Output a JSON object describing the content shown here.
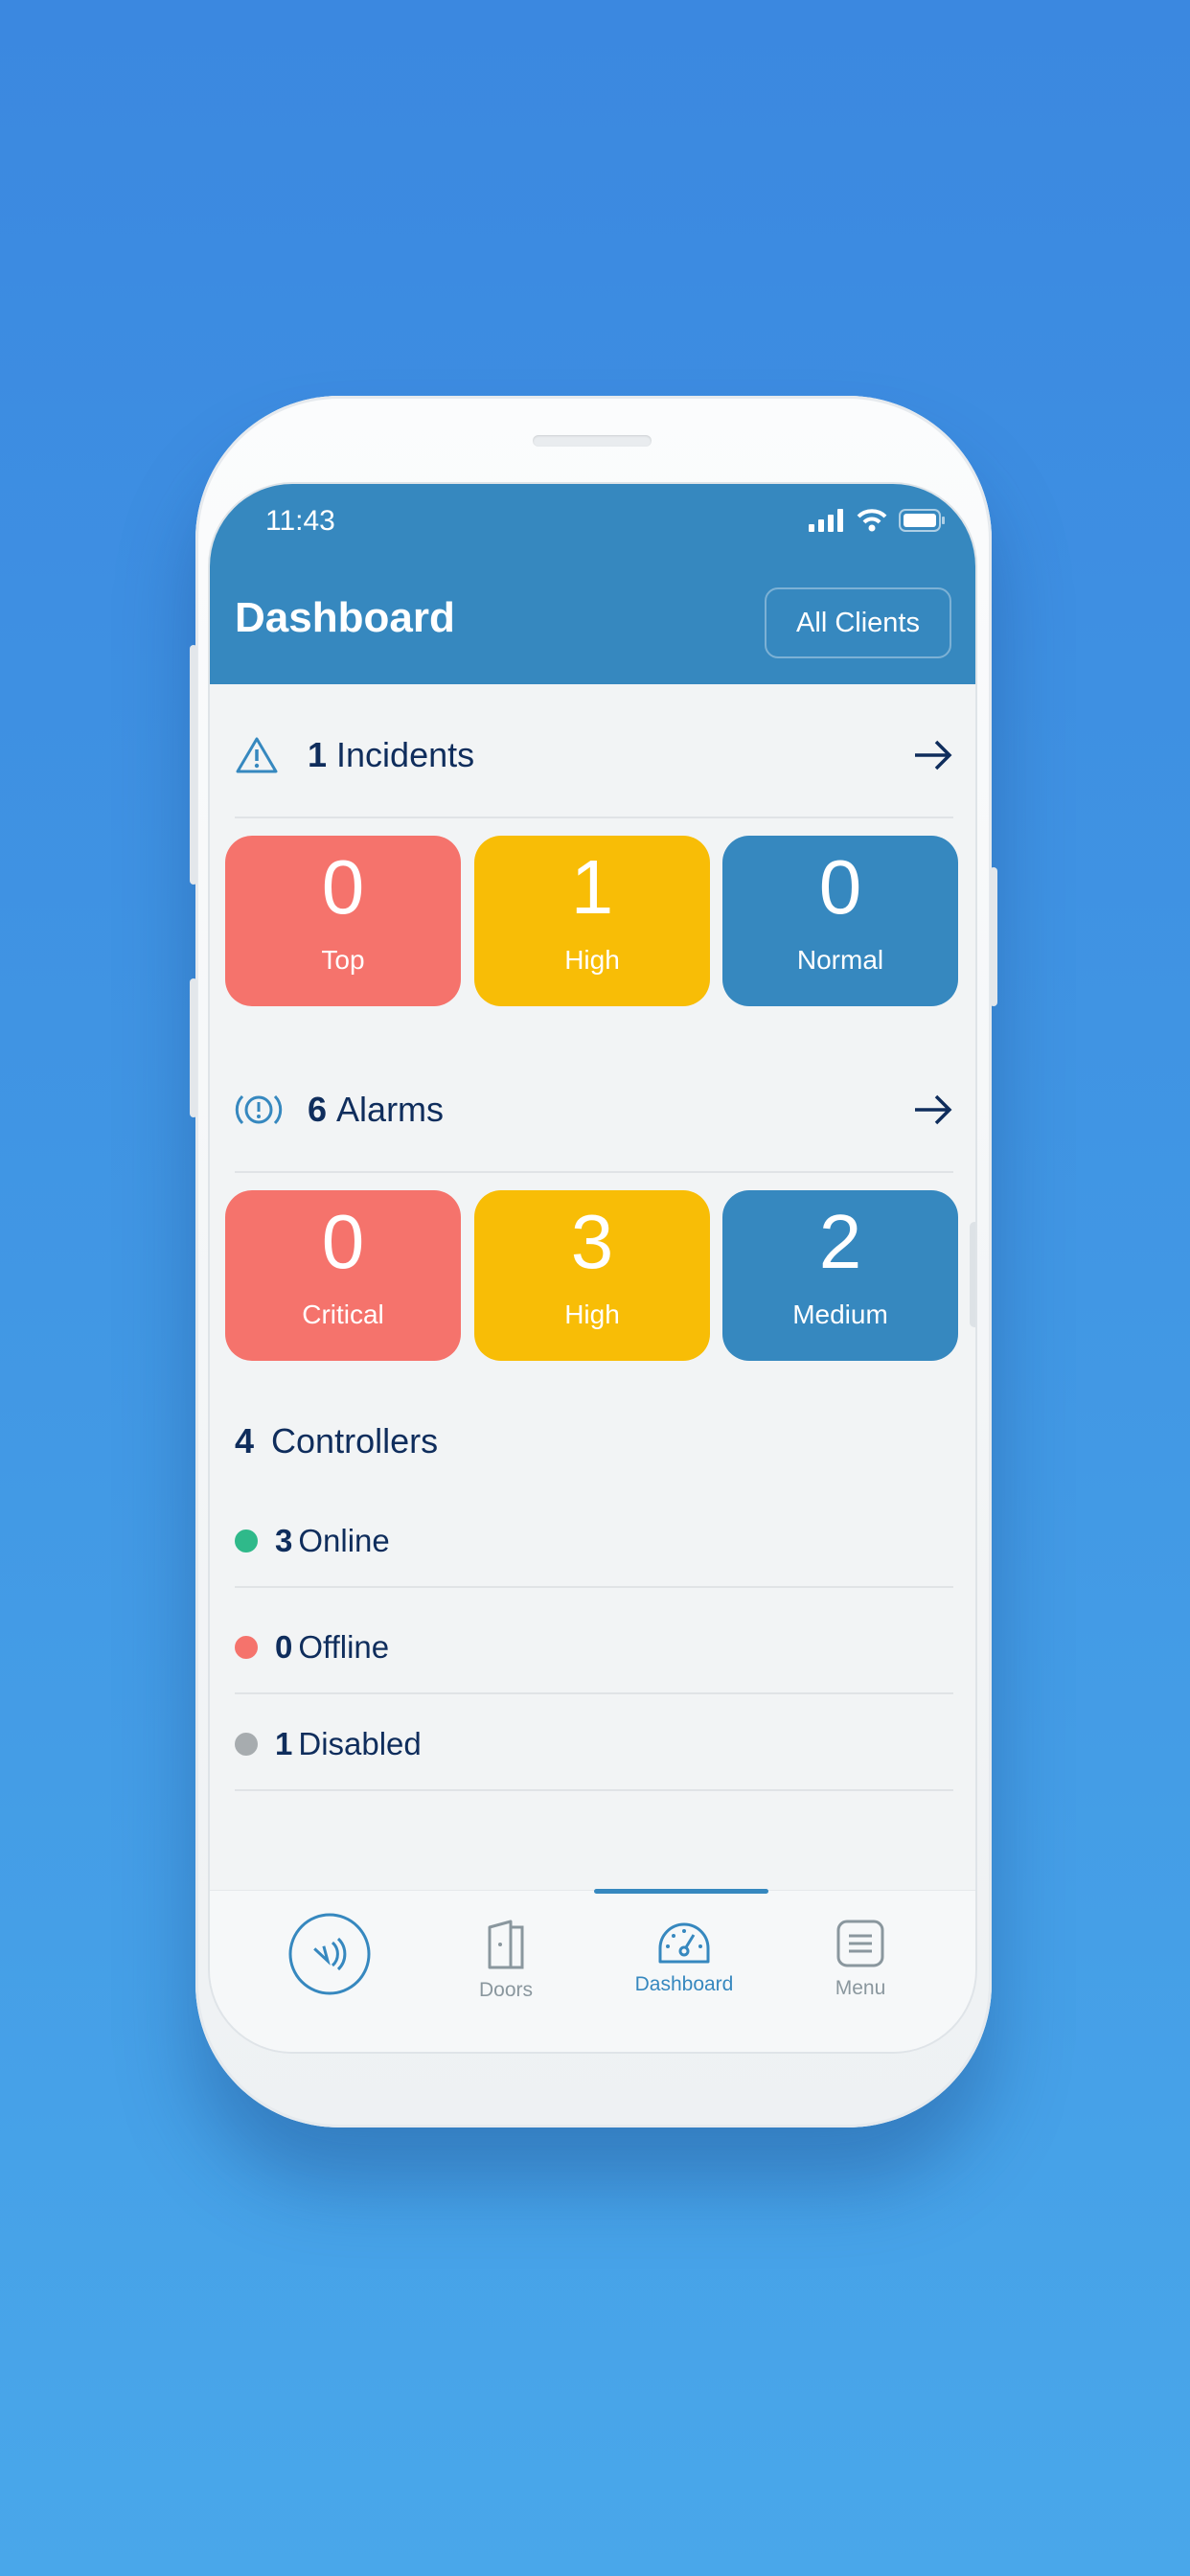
{
  "status_bar": {
    "time": "11:43"
  },
  "header": {
    "title": "Dashboard",
    "clients_button": "All Clients"
  },
  "incidents": {
    "count": "1",
    "label": "Incidents",
    "cards": [
      {
        "value": "0",
        "label": "Top",
        "color": "#f5736c"
      },
      {
        "value": "1",
        "label": "High",
        "color": "#f8bd06"
      },
      {
        "value": "0",
        "label": "Normal",
        "color": "#3688bf"
      }
    ]
  },
  "alarms": {
    "count": "6",
    "label": "Alarms",
    "cards": [
      {
        "value": "0",
        "label": "Critical",
        "color": "#f5736c"
      },
      {
        "value": "3",
        "label": "High",
        "color": "#f8bd06"
      },
      {
        "value": "2",
        "label": "Medium",
        "color": "#3688bf"
      }
    ]
  },
  "controllers": {
    "count": "4",
    "label": "Controllers",
    "items": [
      {
        "count": "3",
        "label": "Online",
        "color": "#2fb98a"
      },
      {
        "count": "0",
        "label": "Offline",
        "color": "#f5736c"
      },
      {
        "count": "1",
        "label": "Disabled",
        "color": "#a7acaf"
      }
    ]
  },
  "nav": {
    "items": [
      {
        "label": "Doors"
      },
      {
        "label": "Dashboard",
        "active": true
      },
      {
        "label": "Menu"
      }
    ]
  },
  "colors": {
    "accent": "#3688bf",
    "text": "#0f2d5c"
  }
}
